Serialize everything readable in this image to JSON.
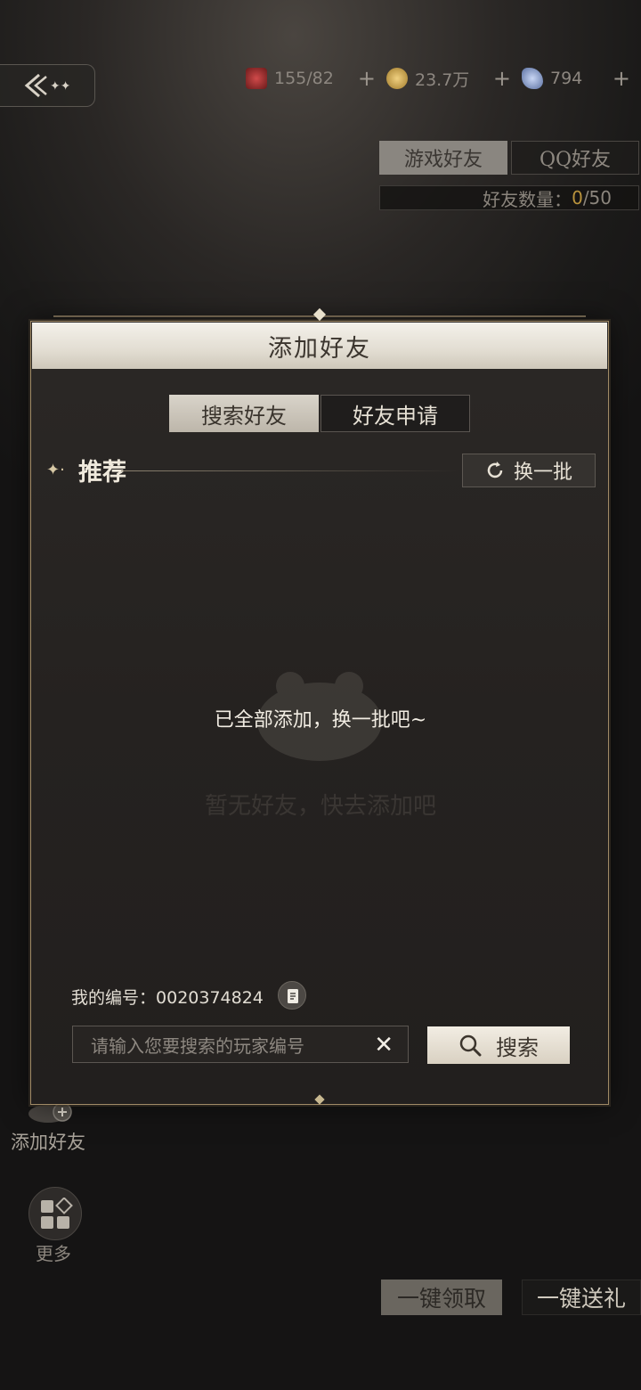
{
  "resources": {
    "stamina": {
      "value": "155/82",
      "icon": "wine-glass-icon",
      "color": "#b03a3a"
    },
    "gold": {
      "value": "23.7万",
      "icon": "gold-coin-icon",
      "color": "#d9b15a"
    },
    "gems": {
      "value": "794",
      "icon": "crystal-icon",
      "color": "#8ea6d8"
    },
    "plus_label": "+"
  },
  "friend_tabs": {
    "game": "游戏好友",
    "qq": "QQ好友"
  },
  "friend_count": {
    "label": "好友数量：",
    "current": "0",
    "max": "/50"
  },
  "dialog": {
    "title": "添加好友",
    "tabs": {
      "search": "搜索好友",
      "apply": "好友申请"
    },
    "section_title": "推荐",
    "refresh_label": "换一批",
    "empty_message": "已全部添加，换一批吧~",
    "ghost_message": "暂无好友，快去添加吧",
    "my_id_label": "我的编号：",
    "my_id": "0020374824",
    "search_placeholder": "请输入您要搜索的玩家编号",
    "clear_symbol": "✕",
    "search_label": "搜索"
  },
  "side": {
    "add_friend": "添加好友",
    "more": "更多"
  },
  "bottom": {
    "claim_all": "一键领取",
    "gift_all": "一键送礼"
  }
}
